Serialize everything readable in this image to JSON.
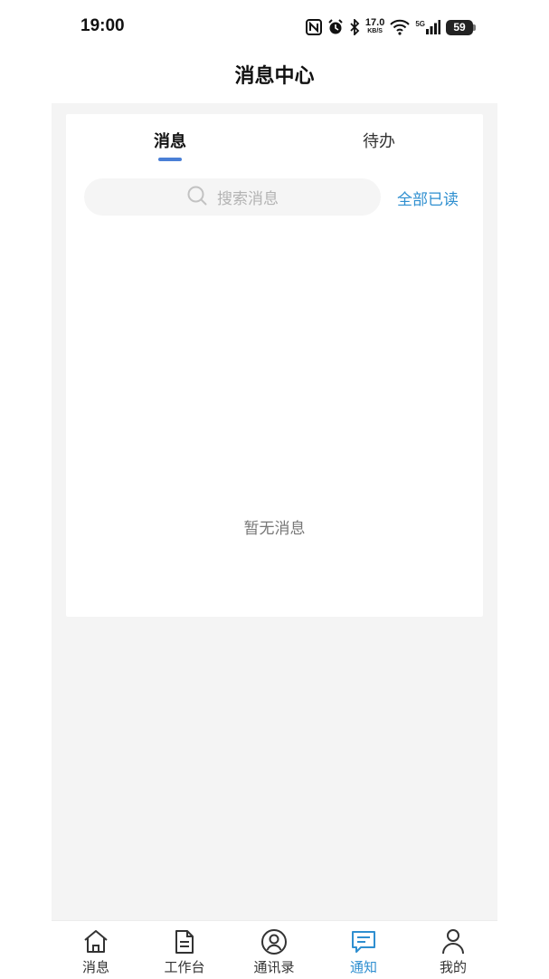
{
  "status_bar": {
    "time": "19:00",
    "net_speed_value": "17.0",
    "net_speed_unit": "KB/S",
    "signal_label": "5G",
    "battery_level": "59",
    "icons": [
      "nfc-icon",
      "alarm-icon",
      "bluetooth-icon",
      "wifi-icon",
      "cellular-signal-icon",
      "battery-icon"
    ]
  },
  "header": {
    "title": "消息中心"
  },
  "tabs": [
    {
      "label": "消息",
      "active": true
    },
    {
      "label": "待办",
      "active": false
    }
  ],
  "search": {
    "placeholder": "搜索消息",
    "icon": "search-icon"
  },
  "actions": {
    "mark_all_read": "全部已读"
  },
  "empty_state": {
    "text": "暂无消息"
  },
  "accent_color": "#2f8fd0",
  "indicator_color": "#4a7fd6",
  "bottom_nav": [
    {
      "label": "消息",
      "icon": "home-icon",
      "active": false
    },
    {
      "label": "工作台",
      "icon": "document-icon",
      "active": false
    },
    {
      "label": "通讯录",
      "icon": "contact-icon",
      "active": false
    },
    {
      "label": "通知",
      "icon": "chat-icon",
      "active": true
    },
    {
      "label": "我的",
      "icon": "user-icon",
      "active": false
    }
  ]
}
